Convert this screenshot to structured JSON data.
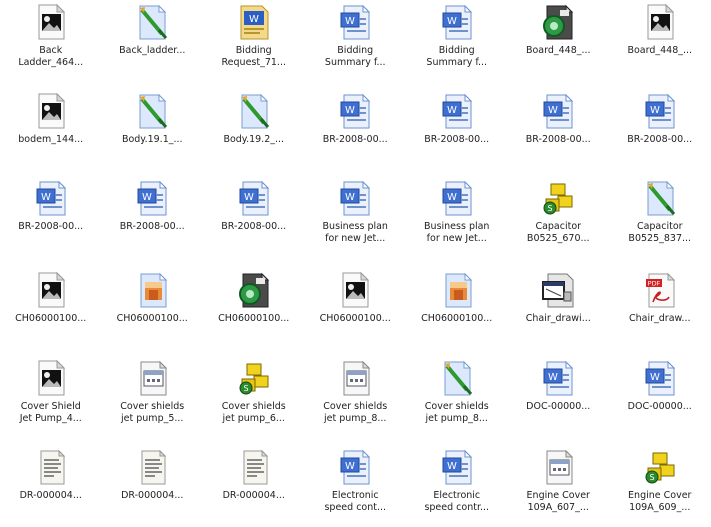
{
  "files": [
    {
      "icon": "image-file-icon",
      "line1": "Back",
      "line2": "Ladder_464..."
    },
    {
      "icon": "paint-file-icon",
      "line1": "Back_ladder...",
      "line2": ""
    },
    {
      "icon": "word-template-icon",
      "line1": "Bidding",
      "line2": "Request_71..."
    },
    {
      "icon": "word-document-icon",
      "line1": "Bidding",
      "line2": "Summary f..."
    },
    {
      "icon": "word-document-icon",
      "line1": "Bidding",
      "line2": "Summary f..."
    },
    {
      "icon": "cad-file-icon",
      "line1": "Board_448_...",
      "line2": ""
    },
    {
      "icon": "image-file-icon",
      "line1": "Board_448_...",
      "line2": ""
    },
    {
      "icon": "image-file-icon",
      "line1": "bodem_144...",
      "line2": ""
    },
    {
      "icon": "paint-file-icon",
      "line1": "Body.19.1_...",
      "line2": ""
    },
    {
      "icon": "paint-file-icon",
      "line1": "Body.19.2_...",
      "line2": ""
    },
    {
      "icon": "word-document-icon",
      "line1": "BR-2008-00...",
      "line2": ""
    },
    {
      "icon": "word-document-icon",
      "line1": "BR-2008-00...",
      "line2": ""
    },
    {
      "icon": "word-document-icon",
      "line1": "BR-2008-00...",
      "line2": ""
    },
    {
      "icon": "word-document-icon",
      "line1": "BR-2008-00...",
      "line2": ""
    },
    {
      "icon": "word-document-icon",
      "line1": "BR-2008-00...",
      "line2": ""
    },
    {
      "icon": "word-document-icon",
      "line1": "BR-2008-00...",
      "line2": ""
    },
    {
      "icon": "word-document-icon",
      "line1": "BR-2008-00...",
      "line2": ""
    },
    {
      "icon": "word-document-icon",
      "line1": "Business plan",
      "line2": "for new Jet..."
    },
    {
      "icon": "word-document-icon",
      "line1": "Business plan",
      "line2": "for new Jet..."
    },
    {
      "icon": "assembly-file-icon",
      "line1": "Capacitor",
      "line2": "B0525_670..."
    },
    {
      "icon": "paint-file-icon",
      "line1": "Capacitor",
      "line2": "B0525_837..."
    },
    {
      "icon": "image-file-icon",
      "line1": "CH06000100...",
      "line2": ""
    },
    {
      "icon": "photo-file-icon",
      "line1": "CH06000100...",
      "line2": ""
    },
    {
      "icon": "cad-file-icon",
      "line1": "CH06000100...",
      "line2": ""
    },
    {
      "icon": "image-file-icon",
      "line1": "CH06000100...",
      "line2": ""
    },
    {
      "icon": "photo-file-icon",
      "line1": "CH06000100...",
      "line2": ""
    },
    {
      "icon": "drawing-file-icon",
      "line1": "Chair_drawi...",
      "line2": ""
    },
    {
      "icon": "pdf-file-icon",
      "line1": "Chair_draw...",
      "line2": ""
    },
    {
      "icon": "image-file-icon",
      "line1": "Cover Shield",
      "line2": "Jet Pump_4..."
    },
    {
      "icon": "window-file-icon",
      "line1": "Cover shields",
      "line2": "jet pump_5..."
    },
    {
      "icon": "assembly-file-icon",
      "line1": "Cover shields",
      "line2": "jet pump_6..."
    },
    {
      "icon": "window-file-icon",
      "line1": "Cover shields",
      "line2": "jet pump_8..."
    },
    {
      "icon": "paint-file-icon",
      "line1": "Cover shields",
      "line2": "jet pump_8..."
    },
    {
      "icon": "word-document-icon",
      "line1": "DOC-00000...",
      "line2": ""
    },
    {
      "icon": "word-document-icon",
      "line1": "DOC-00000...",
      "line2": ""
    },
    {
      "icon": "text-file-icon",
      "line1": "DR-000004...",
      "line2": ""
    },
    {
      "icon": "text-file-icon",
      "line1": "DR-000004...",
      "line2": ""
    },
    {
      "icon": "text-file-icon",
      "line1": "DR-000004...",
      "line2": ""
    },
    {
      "icon": "word-document-icon",
      "line1": "Electronic",
      "line2": "speed cont..."
    },
    {
      "icon": "word-document-icon",
      "line1": "Electronic",
      "line2": "speed contr..."
    },
    {
      "icon": "window-file-icon",
      "line1": "Engine Cover",
      "line2": "109A_607_..."
    },
    {
      "icon": "assembly-file-icon",
      "line1": "Engine Cover",
      "line2": "109A_609_..."
    }
  ]
}
